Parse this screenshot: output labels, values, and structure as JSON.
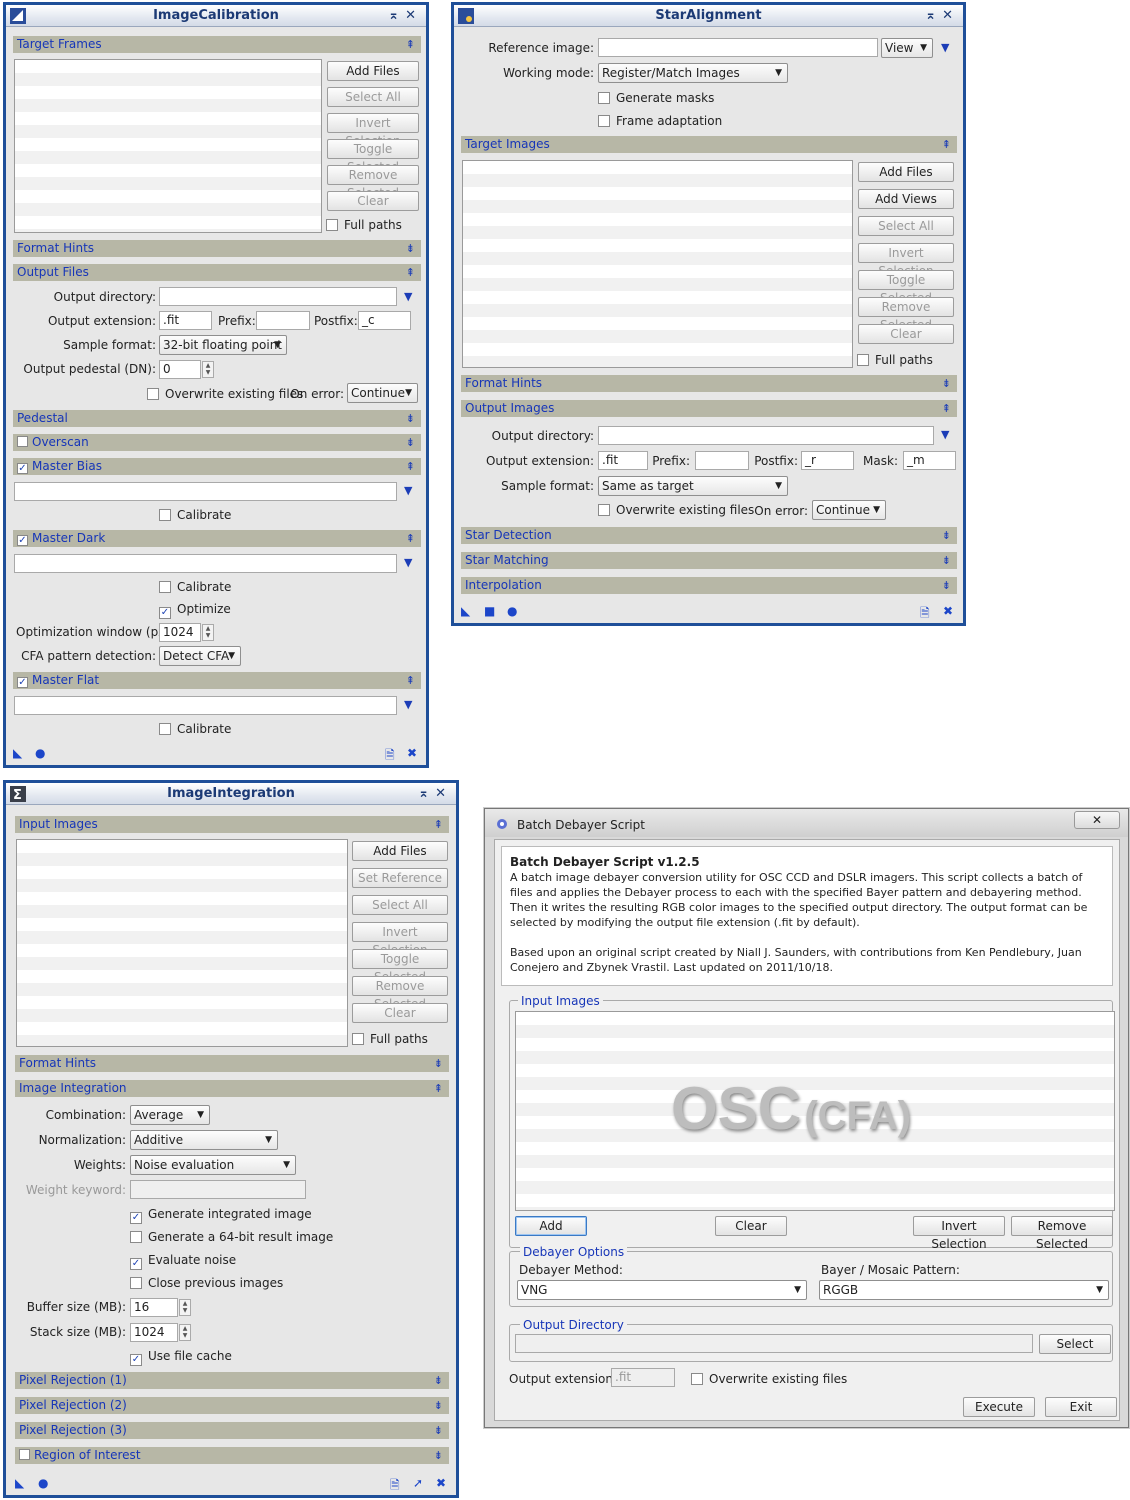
{
  "ic": {
    "title": "ImageCalibration",
    "target_frames": "Target Frames",
    "buttons": [
      "Add Files",
      "Select All",
      "Invert Selection",
      "Toggle Selected",
      "Remove Selected",
      "Clear"
    ],
    "full_paths": "Full paths",
    "format_hints": "Format Hints",
    "output_files": "Output Files",
    "output_directory": "Output directory:",
    "output_extension": "Output extension:",
    "ext_val": ".fit",
    "prefix": "Prefix:",
    "postfix": "Postfix:",
    "postfix_val": "_c",
    "sample_format": "Sample format:",
    "sample_val": "32-bit floating point",
    "pedestal_lbl": "Output pedestal (DN):",
    "pedestal_val": "0",
    "overwrite": "Overwrite existing files",
    "on_error": "On error:",
    "on_error_val": "Continue",
    "pedestal": "Pedestal",
    "overscan": "Overscan",
    "master_bias": "Master Bias",
    "calibrate": "Calibrate",
    "master_dark": "Master Dark",
    "optimize": "Optimize",
    "opt_window": "Optimization window (px):",
    "opt_window_val": "1024",
    "cfa": "CFA pattern detection:",
    "cfa_val": "Detect CFA",
    "master_flat": "Master Flat"
  },
  "sa": {
    "title": "StarAlignment",
    "ref_image": "Reference image:",
    "view": "View",
    "working_mode": "Working mode:",
    "working_mode_val": "Register/Match Images",
    "gen_masks": "Generate masks",
    "frame_adapt": "Frame adaptation",
    "target_images": "Target Images",
    "buttons": [
      "Add Files",
      "Add Views",
      "Select All",
      "Invert Selection",
      "Toggle Selected",
      "Remove Selected",
      "Clear"
    ],
    "full_paths": "Full paths",
    "format_hints": "Format Hints",
    "output_images": "Output Images",
    "output_directory": "Output directory:",
    "output_extension": "Output extension:",
    "ext_val": ".fit",
    "prefix": "Prefix:",
    "postfix": "Postfix:",
    "postfix_val": "_r",
    "mask": "Mask:",
    "mask_val": "_m",
    "sample_format": "Sample format:",
    "sample_val": "Same as target",
    "overwrite": "Overwrite existing files",
    "on_error": "On error:",
    "on_error_val": "Continue",
    "star_detection": "Star Detection",
    "star_matching": "Star Matching",
    "interpolation": "Interpolation"
  },
  "ii": {
    "title": "ImageIntegration",
    "input_images": "Input Images",
    "buttons": [
      "Add Files",
      "Set Reference",
      "Select All",
      "Invert Selection",
      "Toggle Selected",
      "Remove Selected",
      "Clear"
    ],
    "full_paths": "Full paths",
    "format_hints": "Format Hints",
    "image_integration": "Image Integration",
    "combination": "Combination:",
    "combination_val": "Average",
    "normalization": "Normalization:",
    "normalization_val": "Additive",
    "weights": "Weights:",
    "weights_val": "Noise evaluation",
    "weight_keyword": "Weight keyword:",
    "gen_integrated": "Generate integrated image",
    "gen_64": "Generate a 64-bit result image",
    "eval_noise": "Evaluate noise",
    "close_prev": "Close previous images",
    "buffer": "Buffer size (MB):",
    "buffer_val": "16",
    "stack": "Stack size (MB):",
    "stack_val": "1024",
    "use_cache": "Use file cache",
    "pr1": "Pixel Rejection (1)",
    "pr2": "Pixel Rejection (2)",
    "pr3": "Pixel Rejection (3)",
    "roi": "Region of Interest"
  },
  "bd": {
    "title": "Batch Debayer Script",
    "heading": "Batch Debayer Script v1.2.5",
    "desc1": "A batch image debayer conversion utility for OSC CCD and DSLR imagers. This script collects a batch of files and applies the Debayer process to each with the specified Bayer pattern and debayering method. Then it writes the resulting RGB color images to the specified output directory. The output format can be selected by modifying the output file extension (.fit by default).",
    "desc2": "Based upon an original script created by Niall J. Saunders, with contributions from Ken Pendlebury, Juan Conejero and Zbynek Vrastil. Last updated on 2011/10/18.",
    "input_images": "Input Images",
    "watermark_a": "OSC",
    "watermark_b": "(CFA)",
    "add": "Add",
    "clear": "Clear",
    "invert": "Invert Selection",
    "remove": "Remove Selected",
    "debayer_options": "Debayer Options",
    "method": "Debayer Method:",
    "method_val": "VNG",
    "pattern": "Bayer / Mosaic Pattern:",
    "pattern_val": "RGGB",
    "output_directory": "Output Directory",
    "select": "Select",
    "output_ext": "Output extension :",
    "output_ext_val": ".fit",
    "overwrite": "Overwrite existing files",
    "execute": "Execute",
    "exit": "Exit"
  }
}
